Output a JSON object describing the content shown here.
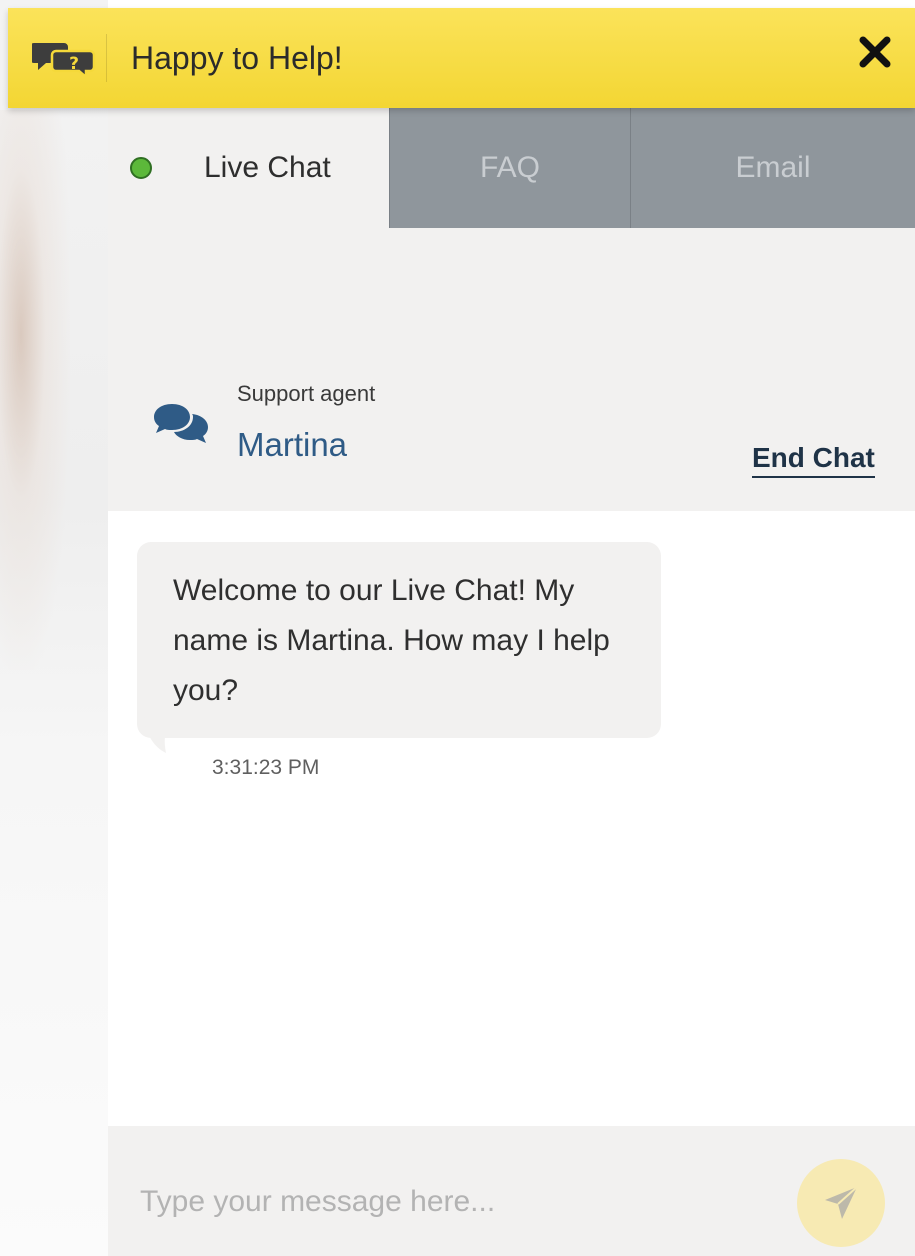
{
  "header": {
    "title": "Happy to Help!",
    "icon": "chat-question-icon",
    "close_icon": "close-icon",
    "bg_color": "#f7dd45"
  },
  "tabs": [
    {
      "label": "Live Chat",
      "active": true,
      "status_color": "#5cb83a"
    },
    {
      "label": "FAQ",
      "active": false
    },
    {
      "label": "Email",
      "active": false
    }
  ],
  "agent": {
    "role": "Support agent",
    "name": "Martina",
    "icon": "chat-bubbles-icon",
    "end_chat_label": "End Chat"
  },
  "messages": [
    {
      "text": "Welcome to our Live Chat! My name is Martina. How may I help you?",
      "time": "3:31:23 PM"
    }
  ],
  "composer": {
    "placeholder": "Type your message here...",
    "send_icon": "send-icon"
  }
}
